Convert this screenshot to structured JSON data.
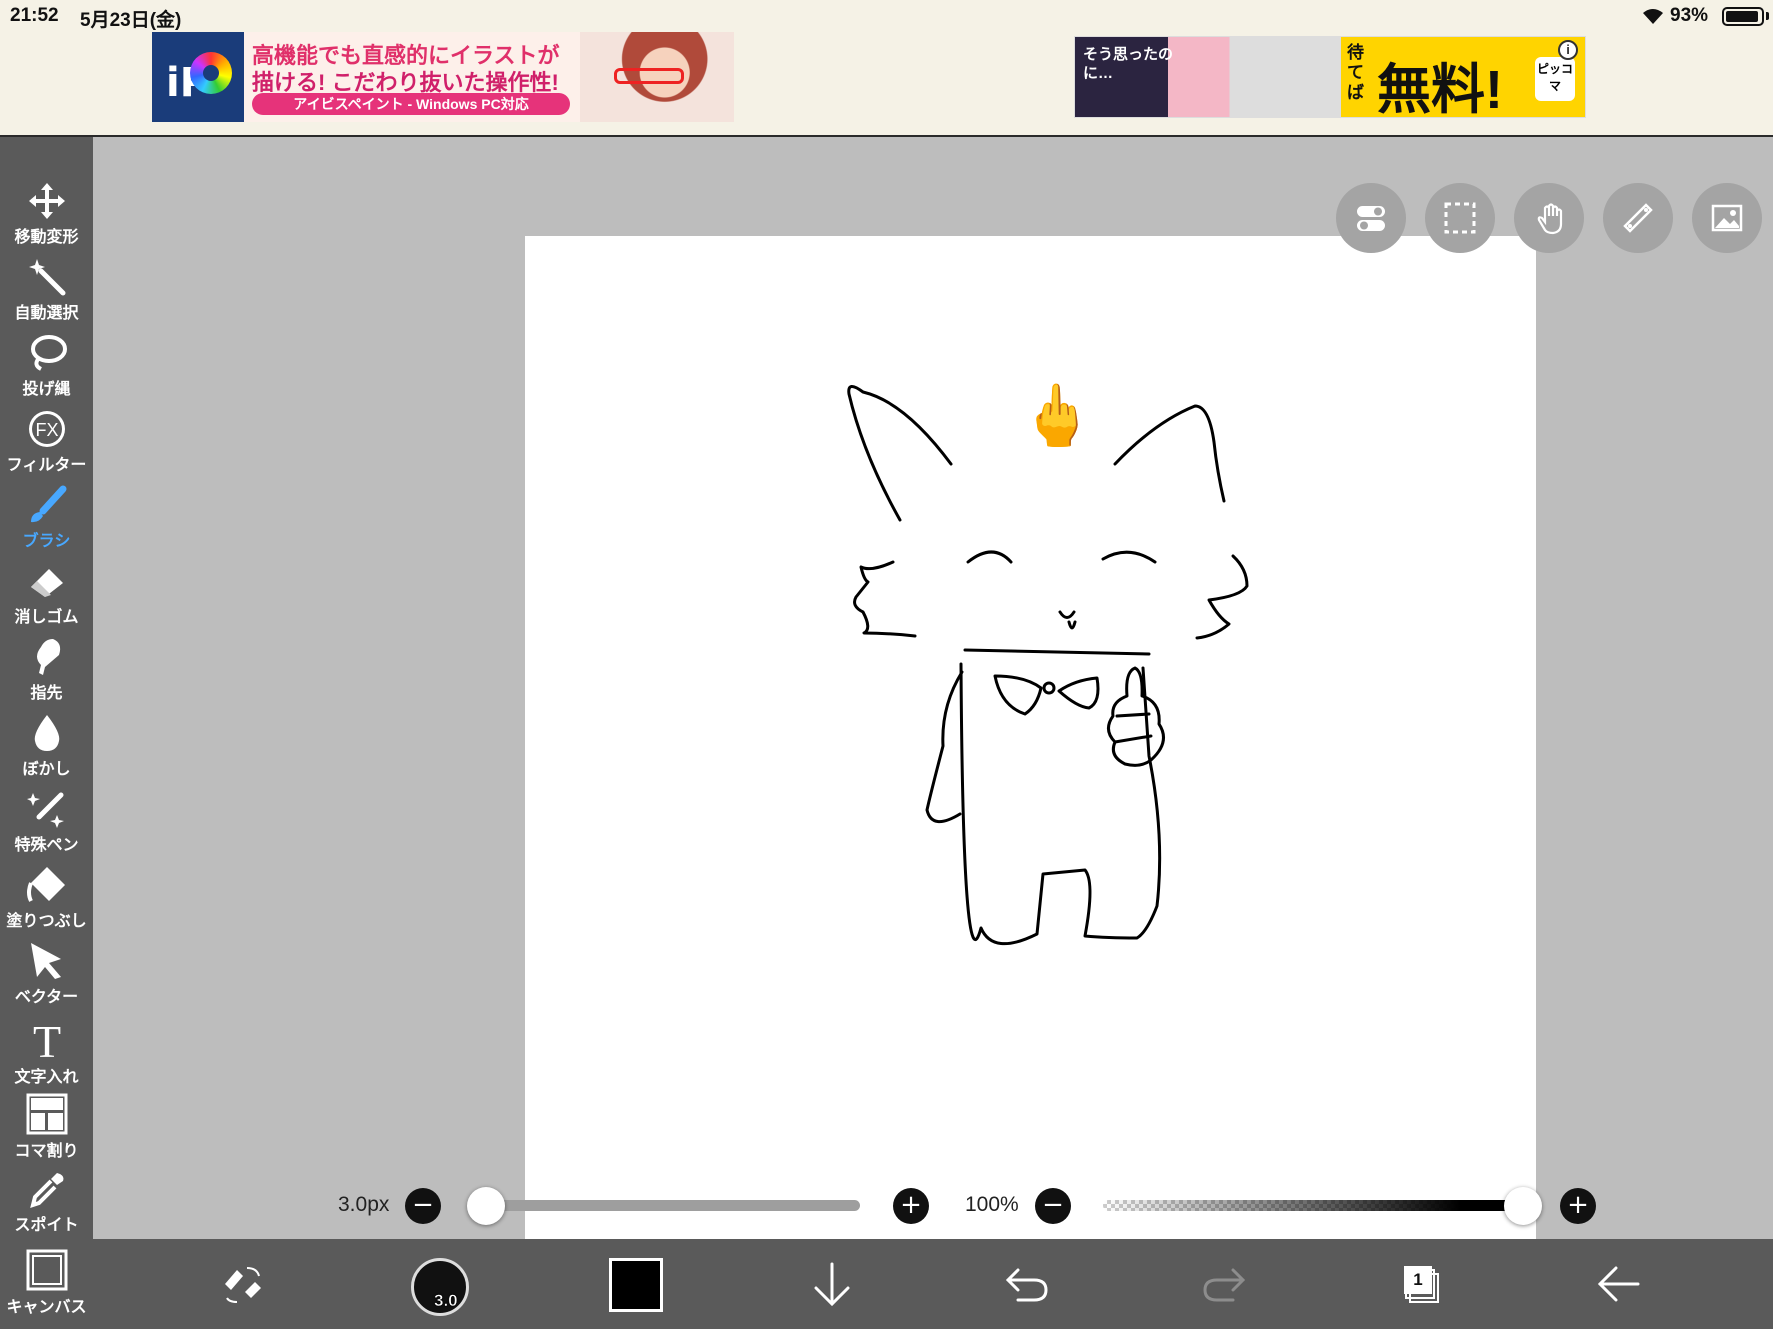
{
  "status_bar": {
    "time": "21:52",
    "date": "5月23日(金)",
    "battery_percent": "93%",
    "battery_level": 0.93
  },
  "ads": {
    "ibis": {
      "logo_text": "iP",
      "line1": "高機能でも直感的にイラストが",
      "line2": "描ける! こだわり抜いた操作性!",
      "pill": "アイビスペイント - Windows PC対応"
    },
    "manga": {
      "bubble": "そう思ったのに…",
      "wait": "待てば",
      "free": "無料!",
      "brand": "ピッコマ",
      "info": "i"
    }
  },
  "tools": [
    {
      "label": "移動変形",
      "icon": "move-icon"
    },
    {
      "label": "自動選択",
      "icon": "magic-wand-icon"
    },
    {
      "label": "投げ縄",
      "icon": "lasso-icon"
    },
    {
      "label": "フィルター",
      "icon": "fx-icon",
      "glyph": "FX"
    },
    {
      "label": "ブラシ",
      "icon": "brush-icon",
      "active": true
    },
    {
      "label": "消しゴム",
      "icon": "eraser-icon"
    },
    {
      "label": "指先",
      "icon": "smudge-icon"
    },
    {
      "label": "ぼかし",
      "icon": "blur-drop-icon"
    },
    {
      "label": "特殊ペン",
      "icon": "special-pen-icon"
    },
    {
      "label": "塗りつぶし",
      "icon": "fill-bucket-icon"
    },
    {
      "label": "ベクター",
      "icon": "vector-arrow-icon"
    },
    {
      "label": "文字入れ",
      "icon": "text-icon",
      "glyph": "T"
    },
    {
      "label": "コマ割り",
      "icon": "panel-split-icon"
    },
    {
      "label": "スポイト",
      "icon": "eyedropper-icon"
    },
    {
      "label": "キャンバス",
      "icon": "canvas-icon"
    }
  ],
  "top_right_buttons": [
    "toggle-icon",
    "selection-icon",
    "hand-icon",
    "ruler-icon",
    "image-icon"
  ],
  "canvas": {
    "emoji_top": "🖕"
  },
  "sliders": {
    "size_label": "3.0px",
    "size_value": 3.0,
    "size_fraction": 0.02,
    "opacity_label": "100%",
    "opacity_fraction": 1.0,
    "minus": "−",
    "plus": "+"
  },
  "bottom_bar": {
    "brush_size_text": "3.0",
    "color": "#000000",
    "layer_count": "1",
    "icons": [
      "swap-tools-icon",
      "brush-size-icon",
      "color-swatch",
      "download-arrow-icon",
      "undo-icon",
      "redo-icon",
      "layers-icon",
      "back-arrow-icon"
    ]
  },
  "colors": {
    "toolbar_bg": "#5a5a5a",
    "canvas_area_bg": "#bdbdbd",
    "active_tool": "#48a8ff",
    "ad_bar_bg": "#f5f2e6"
  }
}
